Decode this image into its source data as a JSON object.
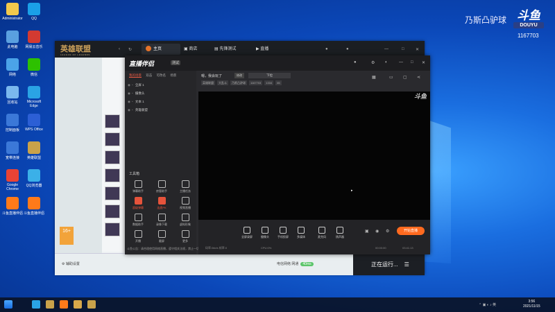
{
  "desktop": {
    "icons": [
      {
        "label": "Administrator",
        "color": "#f2c94c"
      },
      {
        "label": "QQ",
        "color": "#1aa0e8"
      },
      {
        "label": "此电脑",
        "color": "#5aa0e0"
      },
      {
        "label": "网易云音乐",
        "color": "#d33a31"
      },
      {
        "label": "网络",
        "color": "#4ba3e8"
      },
      {
        "label": "微信",
        "color": "#2dc100"
      },
      {
        "label": "回收站",
        "color": "#7ab8ee"
      },
      {
        "label": "Microsoft Edge",
        "color": "#2aa3e5"
      },
      {
        "label": "控制面板",
        "color": "#3b78d8"
      },
      {
        "label": "WPS Office",
        "color": "#2c5fd5"
      },
      {
        "label": "宽带连接",
        "color": "#3b78d8"
      },
      {
        "label": "英雄联盟",
        "color": "#c9a24a"
      },
      {
        "label": "Google Chrome",
        "color": "#ea4335"
      },
      {
        "label": "QQ浏览器",
        "color": "#3bb0e8"
      },
      {
        "label": "斗鱼直播伴侣",
        "color": "#ff7a1a"
      },
      {
        "label": "斗鱼直播伴侣",
        "color": "#ff7a1a"
      }
    ]
  },
  "watermark": {
    "streamer": "乃斯凸驴球",
    "logo": "斗鱼",
    "logo_sub": "DOUYU",
    "room_id": "1167703"
  },
  "lol": {
    "logo": "英雄联盟",
    "logo_sub": "LEAGUE OF LEGENDS",
    "nav": {
      "home": "主页",
      "shop": "商店",
      "pioneer": "先锋测试",
      "live": "直播"
    },
    "badge": "16+",
    "settings": "辅助设置",
    "network": "电信网络 网通",
    "network_ping": "40ms",
    "running": "正在运行..."
  },
  "companion": {
    "title": "直播伴侣",
    "version": "测试",
    "tabs": [
      "我的场景",
      "双击",
      "可改名",
      "场景"
    ],
    "sources": [
      "全屏 1",
      "摄像头",
      "文本 1",
      "英雄联盟"
    ],
    "tools_title": "工具箱",
    "tools": [
      {
        "label": "弹幕助手",
        "red": false
      },
      {
        "label": "房管助手",
        "red": false
      },
      {
        "label": "主播任务",
        "red": false
      },
      {
        "label": "超级弹幕",
        "red": true
      },
      {
        "label": "连麦PK",
        "red": true
      },
      {
        "label": "视频直播",
        "red": false
      },
      {
        "label": "数据助手",
        "red": false
      },
      {
        "label": "录像下载",
        "red": false
      },
      {
        "label": "虚拟形象",
        "red": false
      },
      {
        "label": "开播",
        "red": false
      },
      {
        "label": "截屏",
        "red": false
      },
      {
        "label": "更多",
        "red": false
      }
    ],
    "stream_title": "嗯，我会玩了",
    "edit_label": "修改",
    "category": "下拉",
    "meta": [
      "英雄联盟",
      "大乱斗",
      "乃斯凸驴球",
      "1167703",
      "1334",
      "65"
    ],
    "tip": "斗鱼公告：请合理使用网络直播，遵守相关法规，禁止一切违规",
    "bottom_tools": [
      "全屏录屏",
      "摄像头",
      "手机投屏",
      "多媒体",
      "麦克风",
      "扬声器"
    ],
    "live_button": "开始直播",
    "stats": {
      "bitrate": "码率:0kb/s 帧率:0",
      "cpu": "CPU:0%",
      "time1": "00:00:00",
      "time2": "03:41:13"
    }
  },
  "taskbar": {
    "time": "3:56",
    "date": "2021/11/15"
  }
}
